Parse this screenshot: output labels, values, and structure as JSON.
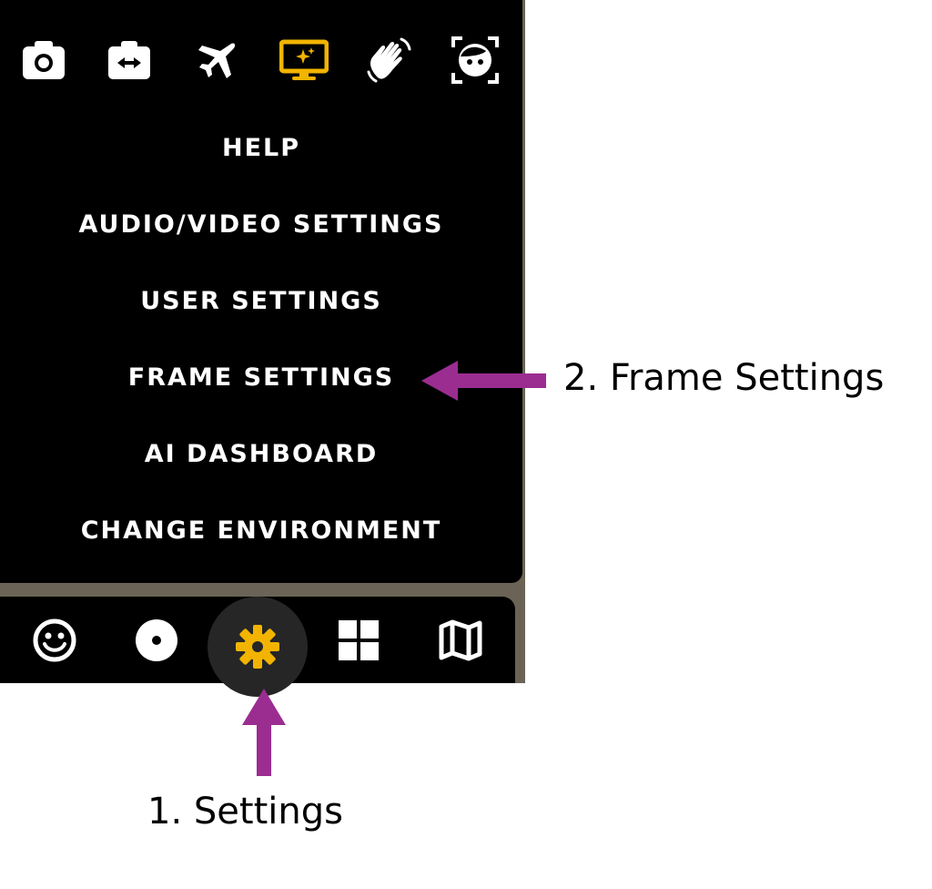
{
  "top_icons": [
    {
      "icon": "camera-icon"
    },
    {
      "icon": "resize-frame-icon"
    },
    {
      "icon": "airplane-icon"
    },
    {
      "icon": "screen-share-icon",
      "color": "#f2b400"
    },
    {
      "icon": "wave-hand-icon"
    },
    {
      "icon": "face-scan-icon"
    }
  ],
  "menu": {
    "items": [
      {
        "label": "HELP"
      },
      {
        "label": "AUDIO/VIDEO SETTINGS"
      },
      {
        "label": "USER SETTINGS"
      },
      {
        "label": "FRAME SETTINGS"
      },
      {
        "label": "AI DASHBOARD"
      },
      {
        "label": "CHANGE ENVIRONMENT"
      }
    ]
  },
  "bottom_bar": {
    "icons": [
      {
        "icon": "smiley-icon"
      },
      {
        "icon": "record-icon"
      },
      {
        "icon": "gear-icon",
        "active": true,
        "color": "#f2b400"
      },
      {
        "icon": "grid-icon"
      },
      {
        "icon": "map-icon"
      }
    ]
  },
  "annotations": {
    "settings": "1. Settings",
    "frame_settings": "2. Frame Settings",
    "arrow_color": "#9b2d91"
  },
  "colors": {
    "accent": "#f2b400",
    "panel": "#000000"
  }
}
